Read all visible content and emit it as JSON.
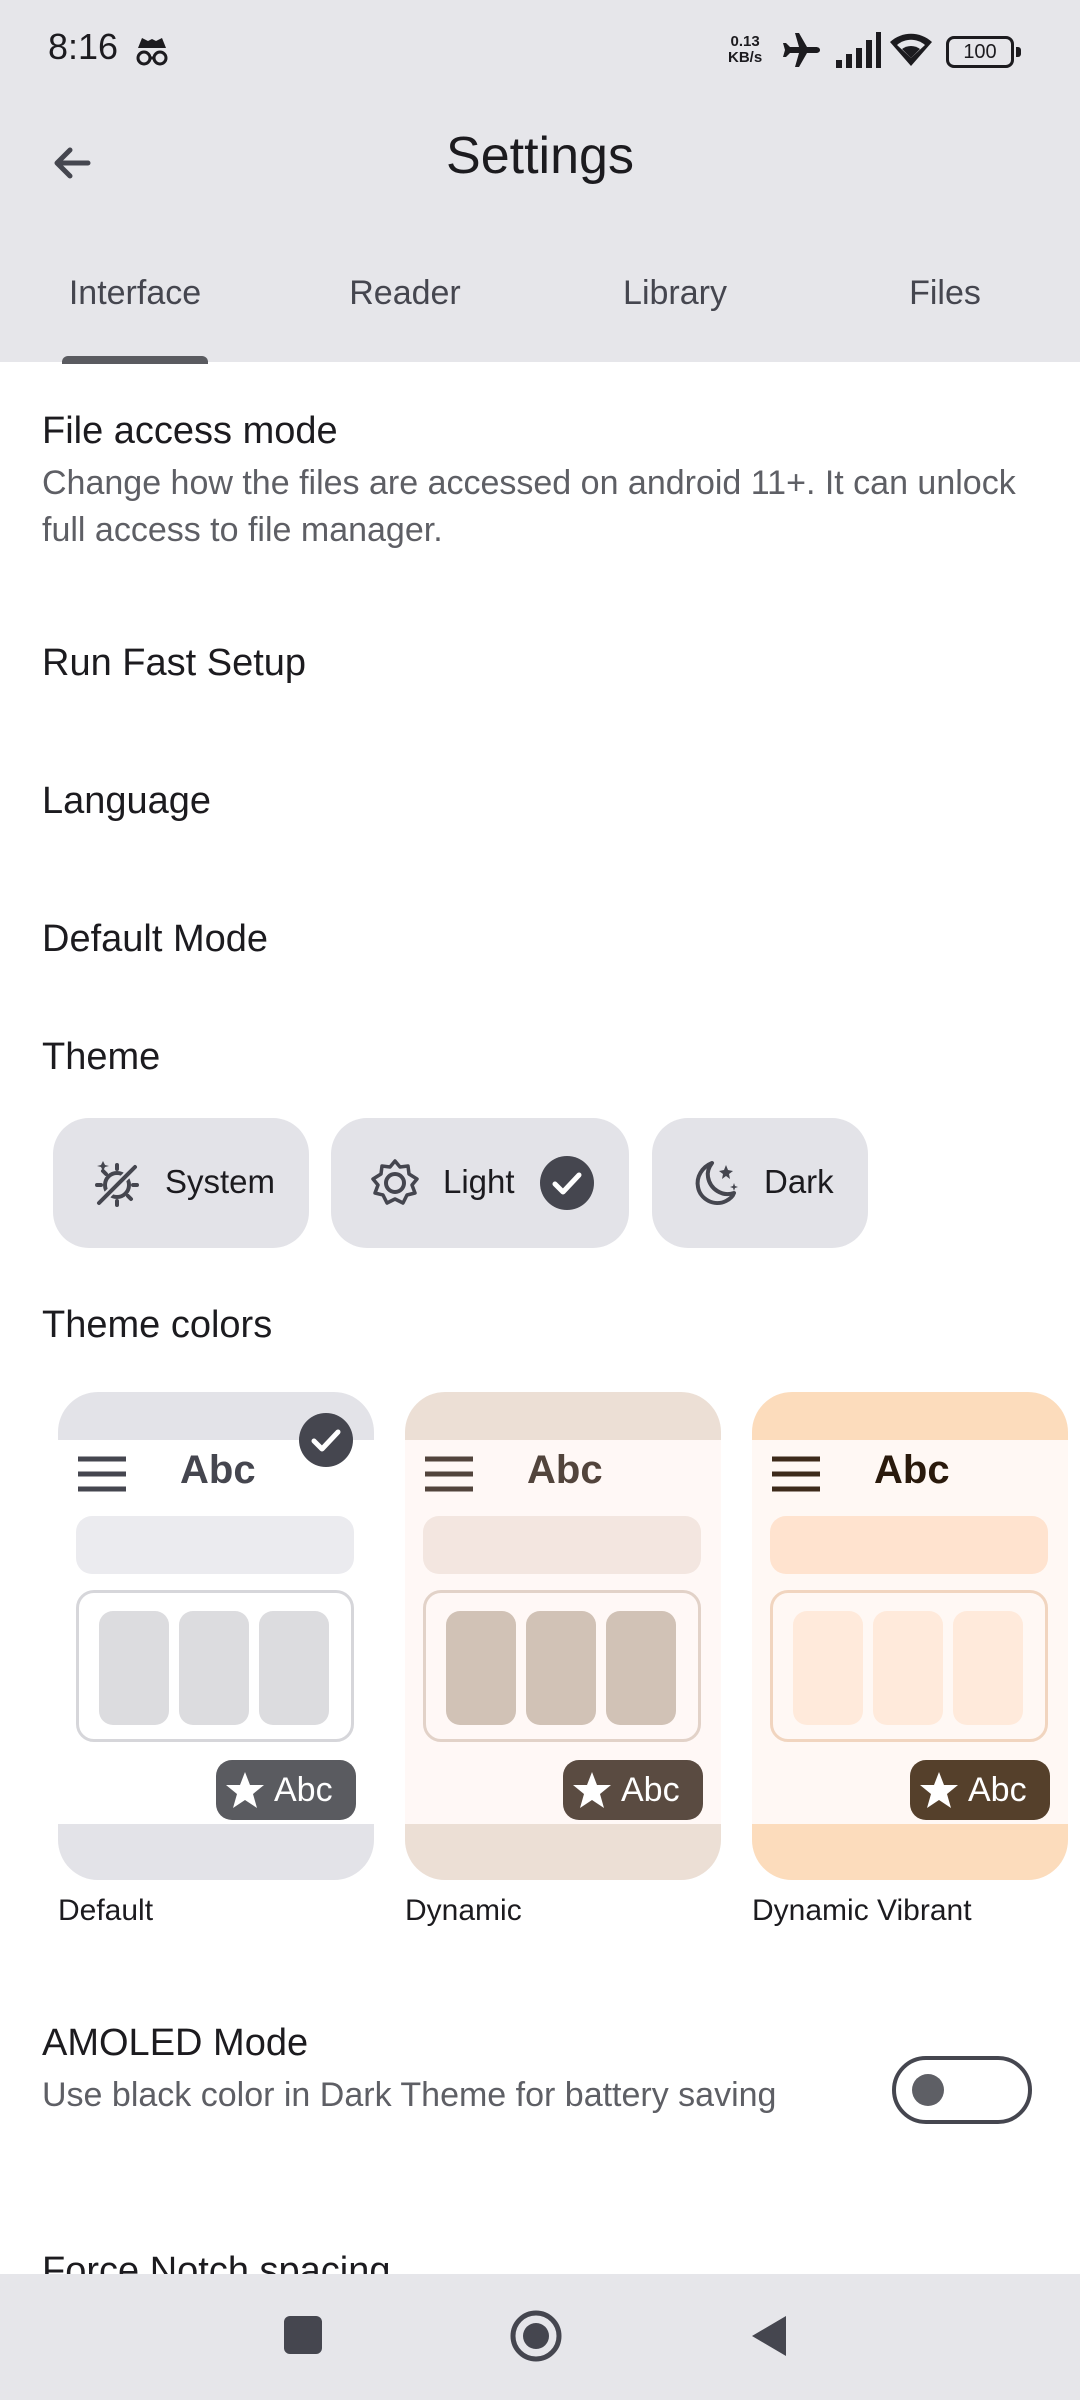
{
  "status_bar": {
    "time": "8:16",
    "net_speed_value": "0.13",
    "net_speed_unit": "KB/s",
    "battery": "100",
    "icons": [
      "incognito-icon",
      "airplane-icon",
      "signal-icon",
      "wifi-icon",
      "battery-icon"
    ]
  },
  "app_bar": {
    "title": "Settings"
  },
  "tabs": [
    {
      "label": "Interface",
      "selected": true
    },
    {
      "label": "Reader",
      "selected": false
    },
    {
      "label": "Library",
      "selected": false
    },
    {
      "label": "Files",
      "selected": false
    }
  ],
  "settings": {
    "file_access": {
      "title": "File access mode",
      "subtitle": "Change how the files are accessed on android 11+. It can unlock full access to file manager."
    },
    "fast_setup": {
      "title": "Run Fast Setup"
    },
    "language": {
      "title": "Language"
    },
    "default_mode": {
      "title": "Default Mode"
    },
    "theme": {
      "title": "Theme",
      "options": [
        {
          "label": "System",
          "icon": "auto-theme-icon",
          "selected": false
        },
        {
          "label": "Light",
          "icon": "sun-icon",
          "selected": true
        },
        {
          "label": "Dark",
          "icon": "moon-icon",
          "selected": false
        }
      ]
    },
    "theme_colors": {
      "title": "Theme colors",
      "cards": [
        {
          "label": "Default",
          "preview_text": "Abc",
          "fab_text": "Abc",
          "selected": true
        },
        {
          "label": "Dynamic",
          "preview_text": "Abc",
          "fab_text": "Abc",
          "selected": false
        },
        {
          "label": "Dynamic Vibrant",
          "preview_text": "Abc",
          "fab_text": "Abc",
          "selected": false
        }
      ]
    },
    "amoled": {
      "title": "AMOLED Mode",
      "subtitle": "Use black color in Dark Theme for battery saving",
      "enabled": false
    },
    "notch": {
      "title": "Force Notch spacing"
    }
  },
  "colors": {
    "app_bar_bg": "#e6e6ea",
    "accent": "#5a5b60",
    "default_card": "#e3e3e8",
    "dynamic_card": "#ecdfd5",
    "vibrant_card": "#fcdcbc"
  }
}
